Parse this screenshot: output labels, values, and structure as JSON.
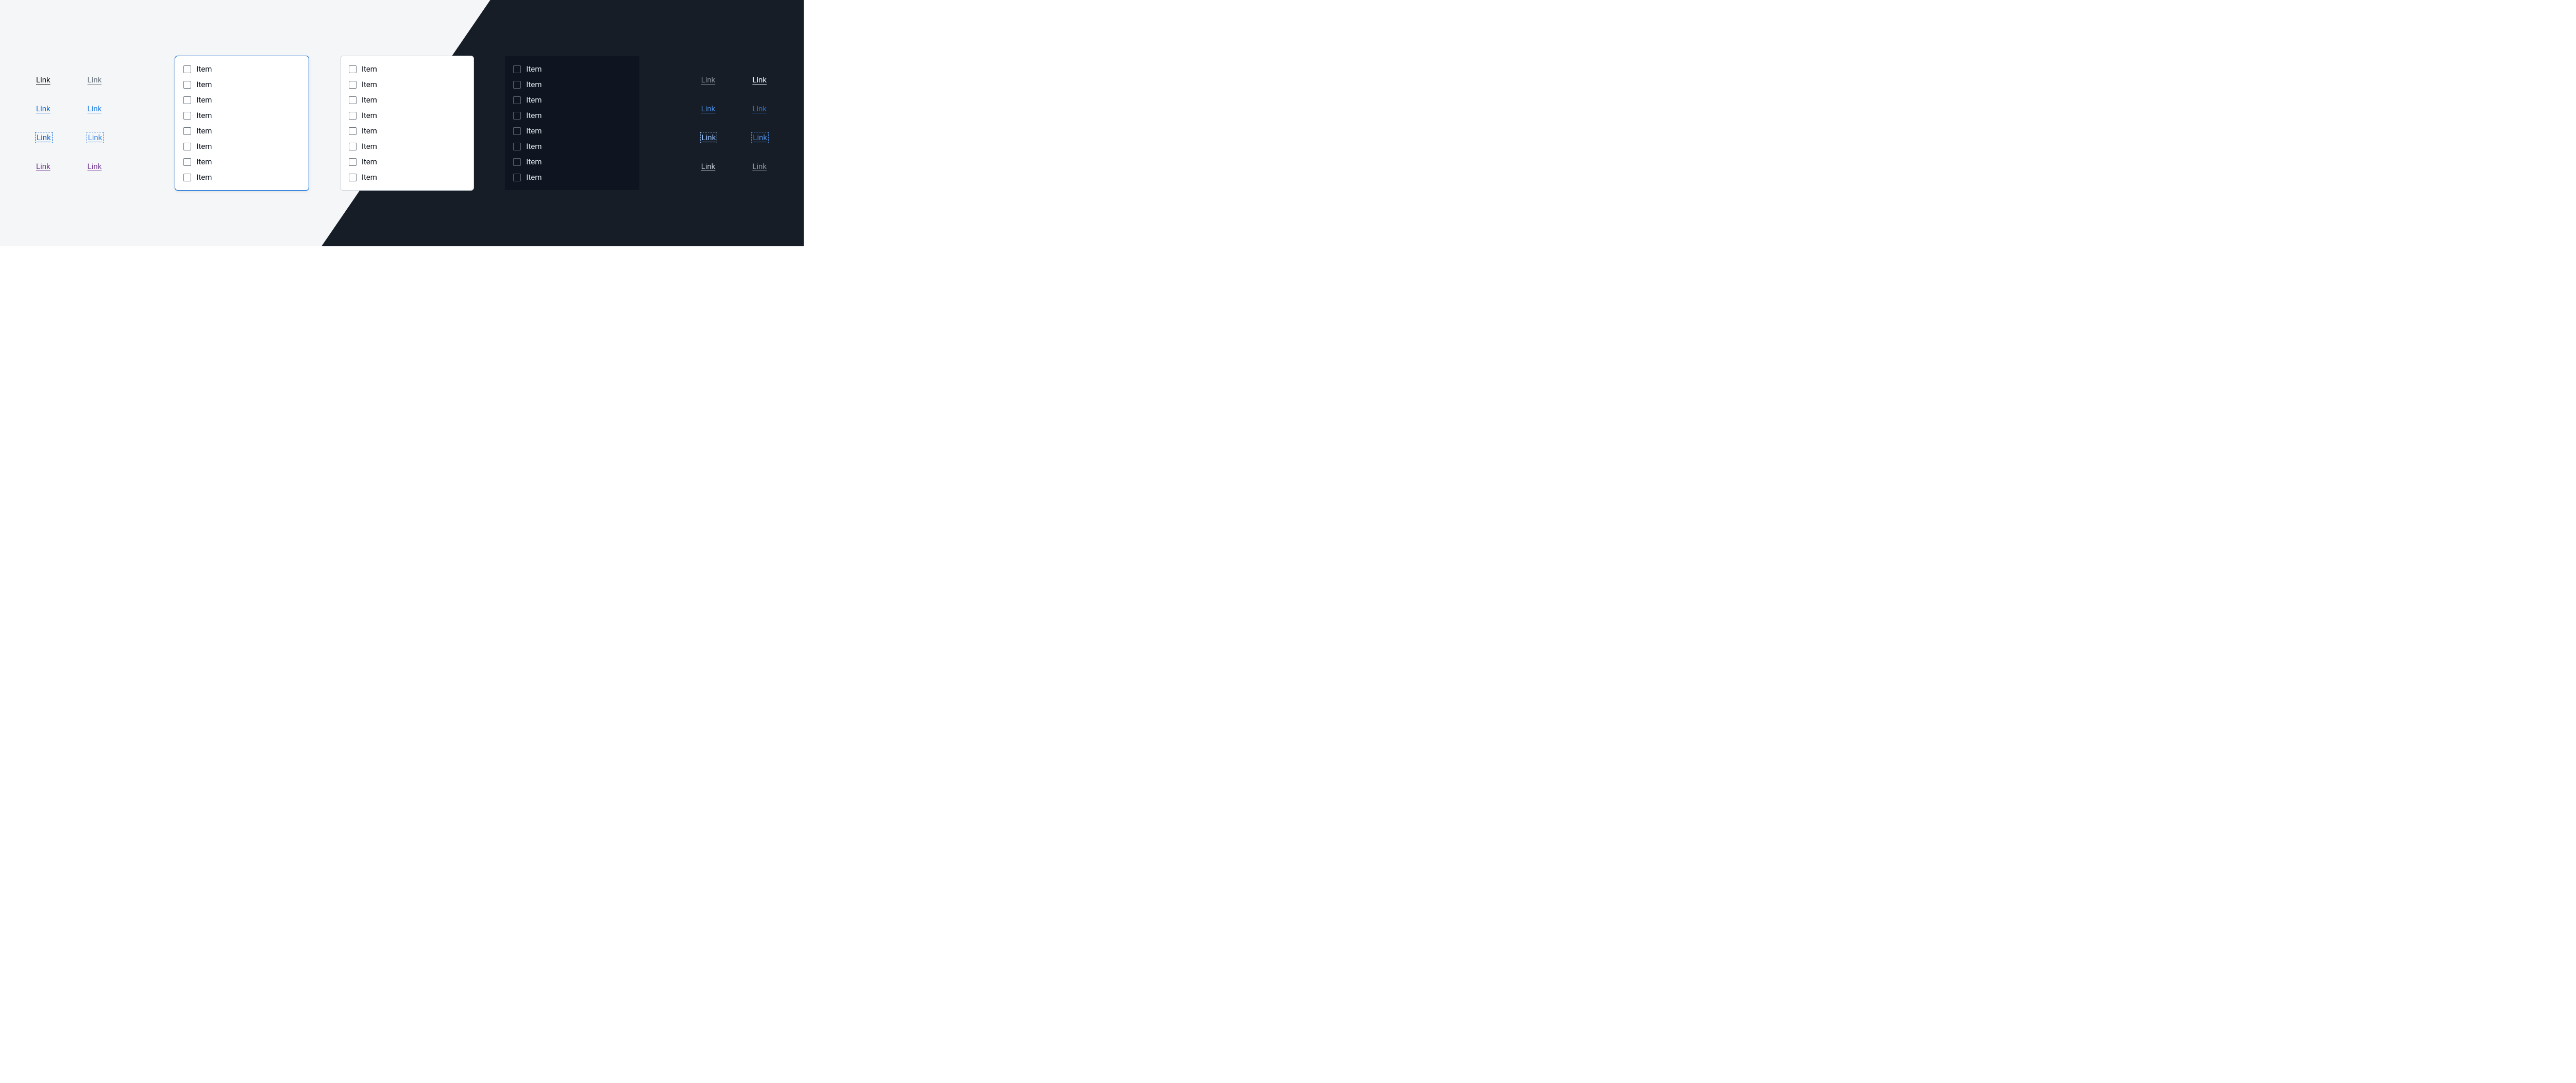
{
  "links": {
    "light": {
      "row1": {
        "a": "Link",
        "b": "Link"
      },
      "row2": {
        "a": "Link",
        "b": "Link"
      },
      "row3": {
        "a": "Link",
        "b": "Link"
      },
      "row4": {
        "a": "Link",
        "b": "Link"
      }
    },
    "dark": {
      "row1": {
        "a": "Link",
        "b": "Link"
      },
      "row2": {
        "a": "Link",
        "b": "Link"
      },
      "row3": {
        "a": "Link",
        "b": "Link"
      },
      "row4": {
        "a": "Link",
        "b": "Link"
      }
    }
  },
  "panels": {
    "selected_light": {
      "items": [
        "Item",
        "Item",
        "Item",
        "Item",
        "Item",
        "Item",
        "Item",
        "Item"
      ]
    },
    "default_light": {
      "items": [
        "Item",
        "Item",
        "Item",
        "Item",
        "Item",
        "Item",
        "Item",
        "Item"
      ]
    },
    "dark": {
      "items": [
        "Item",
        "Item",
        "Item",
        "Item",
        "Item",
        "Item",
        "Item",
        "Item"
      ]
    }
  },
  "colors": {
    "bg_light": "#f5f6f7",
    "bg_dark": "#161d27",
    "accent_blue": "#0969da",
    "border_light": "#d0d7de"
  }
}
